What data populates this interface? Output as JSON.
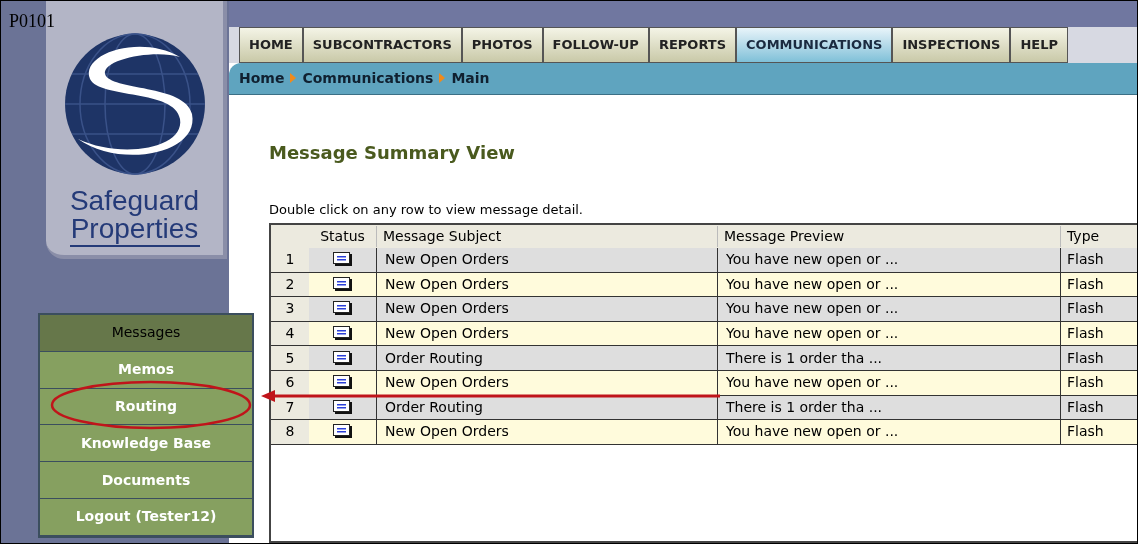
{
  "page_code": "P0101",
  "logo": {
    "lines": [
      "Safeguard",
      "Properties"
    ]
  },
  "tabs": [
    {
      "label": "HOME",
      "selected": false
    },
    {
      "label": "SUBCONTRACTORS",
      "selected": false
    },
    {
      "label": "PHOTOS",
      "selected": false
    },
    {
      "label": "FOLLOW-UP",
      "selected": false
    },
    {
      "label": "REPORTS",
      "selected": false
    },
    {
      "label": "COMMUNICATIONS",
      "selected": true
    },
    {
      "label": "INSPECTIONS",
      "selected": false
    },
    {
      "label": "HELP",
      "selected": false
    }
  ],
  "breadcrumb": [
    "Home",
    "Communications",
    "Main"
  ],
  "heading": "Message Summary View",
  "instruction": "Double click on any row to view message detail.",
  "table": {
    "columns": [
      "Status",
      "Message Subject",
      "Message Preview",
      "Type"
    ],
    "rows": [
      {
        "number": "1",
        "subject": "New Open Orders",
        "preview": "You have new open or ...",
        "type": "Flash"
      },
      {
        "number": "2",
        "subject": "New Open Orders",
        "preview": "You have new open or ...",
        "type": "Flash"
      },
      {
        "number": "3",
        "subject": "New Open Orders",
        "preview": "You have new open or ...",
        "type": "Flash"
      },
      {
        "number": "4",
        "subject": "New Open Orders",
        "preview": "You have new open or ...",
        "type": "Flash"
      },
      {
        "number": "5",
        "subject": "Order Routing",
        "preview": "There is 1 order tha ...",
        "type": "Flash"
      },
      {
        "number": "6",
        "subject": "New Open Orders",
        "preview": "You have new open or ...",
        "type": "Flash"
      },
      {
        "number": "7",
        "subject": "Order Routing",
        "preview": "There is 1 order tha ...",
        "type": "Flash"
      },
      {
        "number": "8",
        "subject": "New Open Orders",
        "preview": "You have new open or ...",
        "type": "Flash"
      }
    ]
  },
  "menu": [
    {
      "label": "Messages",
      "selected": true
    },
    {
      "label": "Memos",
      "selected": false
    },
    {
      "label": "Routing",
      "selected": false
    },
    {
      "label": "Knowledge Base",
      "selected": false
    },
    {
      "label": "Documents",
      "selected": false
    },
    {
      "label": "Logout (Tester12)",
      "selected": false
    }
  ]
}
